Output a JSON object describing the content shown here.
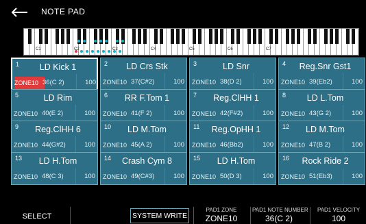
{
  "header": {
    "title": "NOTE PAD"
  },
  "keyboard": {
    "octave_labels": [
      "C1",
      "C2",
      "C3",
      "C4",
      "C5",
      "C6",
      "C7"
    ],
    "marker_colors": {
      "active": "#e03a3a",
      "assigned": "#17b3c6"
    }
  },
  "pads": [
    {
      "num": "1",
      "name": "LD Kick 1",
      "zone": "ZONE10",
      "note": "36(C 2)",
      "vel": "100",
      "selected": true
    },
    {
      "num": "2",
      "name": "LD Crs Stk",
      "zone": "ZONE10",
      "note": "37(C#2)",
      "vel": "100"
    },
    {
      "num": "3",
      "name": "LD Snr",
      "zone": "ZONE10",
      "note": "38(D 2)",
      "vel": "100"
    },
    {
      "num": "4",
      "name": "Reg.Snr Gst1",
      "zone": "ZONE10",
      "note": "39(Eb2)",
      "vel": "100"
    },
    {
      "num": "5",
      "name": "LD Rim",
      "zone": "ZONE10",
      "note": "40(E 2)",
      "vel": "100"
    },
    {
      "num": "6",
      "name": "RR F.Tom 1",
      "zone": "ZONE10",
      "note": "41(F 2)",
      "vel": "100"
    },
    {
      "num": "7",
      "name": "Reg.ClHH 1",
      "zone": "ZONE10",
      "note": "42(F#2)",
      "vel": "100"
    },
    {
      "num": "8",
      "name": "LD L.Tom",
      "zone": "ZONE10",
      "note": "43(G 2)",
      "vel": "100"
    },
    {
      "num": "9",
      "name": "Reg.ClHH 6",
      "zone": "ZONE10",
      "note": "44(G#2)",
      "vel": "100"
    },
    {
      "num": "10",
      "name": "LD M.Tom",
      "zone": "ZONE10",
      "note": "45(A 2)",
      "vel": "100"
    },
    {
      "num": "11",
      "name": "Reg.OpHH 1",
      "zone": "ZONE10",
      "note": "46(Bb2)",
      "vel": "100"
    },
    {
      "num": "12",
      "name": "LD M.Tom",
      "zone": "ZONE10",
      "note": "47(B 2)",
      "vel": "100"
    },
    {
      "num": "13",
      "name": "LD H.Tom",
      "zone": "ZONE10",
      "note": "48(C 3)",
      "vel": "100"
    },
    {
      "num": "14",
      "name": "Crash Cym 8",
      "zone": "ZONE10",
      "note": "49(C#3)",
      "vel": "100"
    },
    {
      "num": "15",
      "name": "LD H.Tom",
      "zone": "ZONE10",
      "note": "50(D 3)",
      "vel": "100"
    },
    {
      "num": "16",
      "name": "Rock Ride 2",
      "zone": "ZONE10",
      "note": "51(Eb3)",
      "vel": "100"
    }
  ],
  "bottom": {
    "select_label": "SELECT",
    "system_write_label": "SYSTEM WRITE",
    "params": [
      {
        "label": "PAD1 ZONE",
        "value": "ZONE10"
      },
      {
        "label": "PAD1 NOTE NUMBER",
        "value": "36(C 2)"
      },
      {
        "label": "PAD1 VELOCITY",
        "value": "100"
      }
    ]
  },
  "colors": {
    "pad_bg": "#2c6f86",
    "pad_border": "#6aa6b8",
    "highlight": "#e03a3a"
  }
}
